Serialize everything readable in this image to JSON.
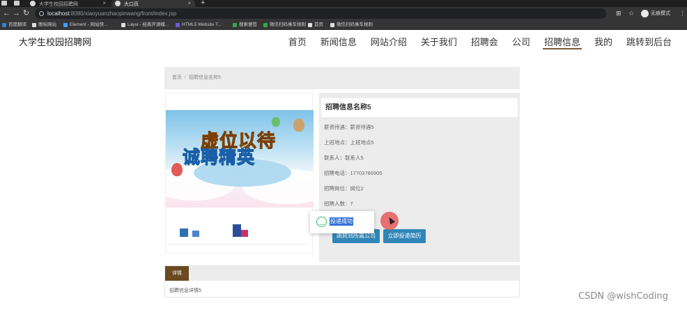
{
  "browser": {
    "tabs": [
      {
        "title": "大学生校园招聘网",
        "active": false
      },
      {
        "title": "大口页",
        "active": true
      }
    ],
    "address": {
      "host": "localhost",
      "path": ":8080/xiaoyuanzhaopinwang/front/index.jsp"
    },
    "profile_label": "无痕模式",
    "bookmarks": [
      {
        "label": "百度翻译",
        "color": "#3b7bd9"
      },
      {
        "label": "图标网站",
        "color": "#e0e0e0"
      },
      {
        "label": "Element - 网站快...",
        "color": "#409eff"
      },
      {
        "label": "Layui - 经典开源模...",
        "color": "#e0e0e0"
      },
      {
        "label": "HTML5 Website T...",
        "color": "#6b5bd6"
      },
      {
        "label": "搜索便签",
        "color": "#2fa84f"
      },
      {
        "label": "微信扫码乘车规则",
        "color": "#2fa84f"
      },
      {
        "label": "首页",
        "color": "#e0e0e0"
      },
      {
        "label": "微信扫码乘车规则",
        "color": "#e0e0e0"
      }
    ]
  },
  "site": {
    "title": "大学生校园招聘网",
    "nav": [
      "首页",
      "新闻信息",
      "网站介绍",
      "关于我们",
      "招聘会",
      "公司",
      "招聘信息",
      "我的",
      "跳转到后台"
    ],
    "nav_active": "招聘信息"
  },
  "breadcrumb": {
    "home": "首页",
    "separator": "/",
    "current": "招聘信息名称5"
  },
  "banner": {
    "line1": "虚位以待",
    "line2": "诚聘精英"
  },
  "job": {
    "title": "招聘信息名称5",
    "fields": [
      {
        "label": "薪资待遇：",
        "value": "薪资待遇5"
      },
      {
        "label": "上班地点：",
        "value": "上班地点5"
      },
      {
        "label": "联系人：",
        "value": "联系人5"
      },
      {
        "label": "招聘电话：",
        "value": "17703786905"
      },
      {
        "label": "招聘岗位：",
        "value": "岗位2"
      },
      {
        "label": "招聘人数：",
        "value": "7"
      }
    ],
    "buttons": {
      "company": "跳转到所属公司",
      "apply": "立即投递简历"
    }
  },
  "toast": {
    "message": "投递成功"
  },
  "detail": {
    "tab_label": "详情",
    "content": "招聘信息详情5"
  },
  "watermark": "CSDN @wishCoding"
}
